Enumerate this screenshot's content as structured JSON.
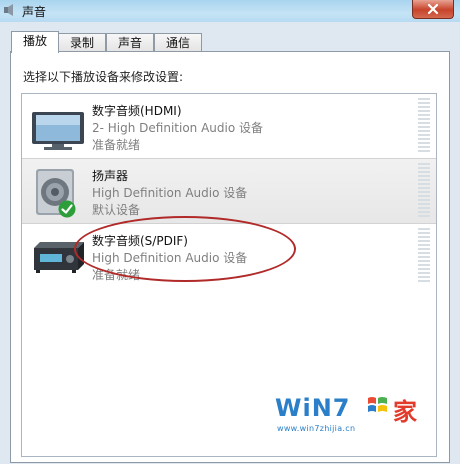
{
  "window": {
    "title": "声音"
  },
  "tabs": [
    {
      "label": "播放",
      "active": true
    },
    {
      "label": "录制",
      "active": false
    },
    {
      "label": "声音",
      "active": false
    },
    {
      "label": "通信",
      "active": false
    }
  ],
  "instruction": "选择以下播放设备来修改设置:",
  "devices": [
    {
      "name": "数字音频(HDMI)",
      "driver": "2- High Definition Audio 设备",
      "status": "准备就绪",
      "icon": "monitor-icon",
      "selected": false,
      "default": false
    },
    {
      "name": "扬声器",
      "driver": "High Definition Audio 设备",
      "status": "默认设备",
      "icon": "speaker-icon",
      "selected": true,
      "default": true
    },
    {
      "name": "数字音频(S/PDIF)",
      "driver": "High Definition Audio 设备",
      "status": "准备就绪",
      "icon": "receiver-icon",
      "selected": false,
      "default": false
    }
  ],
  "watermark": {
    "brand": "WiN7",
    "char": "家",
    "url": "www.win7zhijia.cn"
  },
  "colors": {
    "accent_green": "#2e9e3a",
    "annotation_red": "#b12a2a",
    "watermark_blue": "#2a7fc8"
  }
}
